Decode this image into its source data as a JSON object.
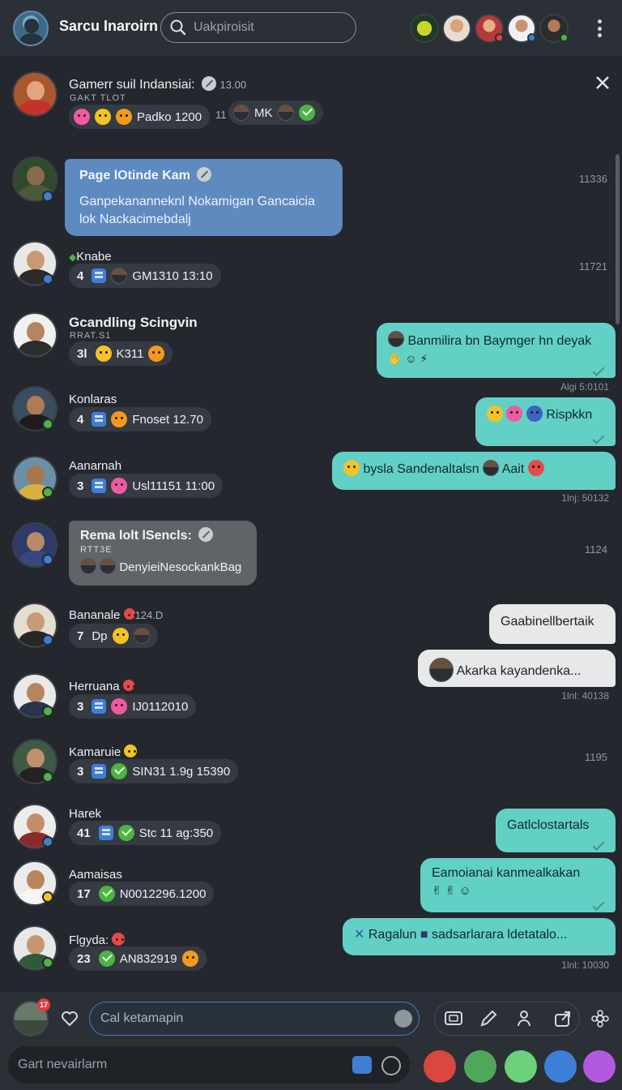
{
  "header": {
    "app_title": "Sarcu Inaroirn",
    "search_placeholder": "Uakpiroisit"
  },
  "pinned": {
    "name": "Gamerr suil Indansiai:",
    "time": "13.00",
    "sub": "GAKT TLOT",
    "chip_text": "Padko 1200",
    "extra_count": "11",
    "extra_chip_text": "MK"
  },
  "rows": [
    {
      "name": "Page lOtinde Kam",
      "message": "Ganpekananneknl Nokamigan Gancaicia lok Nackacimebdalj",
      "time": "11336"
    },
    {
      "name": "Knabe",
      "count": "4",
      "chip_text": "GM1310 13:10",
      "time": "11721"
    },
    {
      "name": "Gcandling Scingvin",
      "sub": "RRAT.S1",
      "count": "3l",
      "chip_text": "K311"
    },
    {
      "name": "Konlaras",
      "count": "4",
      "chip_text": "Fnoset 12.70"
    },
    {
      "name": "Aanarnah",
      "count": "3",
      "chip_text": "Usl11151 11:00"
    },
    {
      "name": "Rema lolt lSencls:",
      "sub": "RTT3E",
      "chip_text": "DenyieiNesockankBag",
      "time": "1124"
    },
    {
      "name": "Bananale",
      "badge_text": "124.D",
      "count": "7",
      "chip_text": "Dp"
    },
    {
      "name": "Herruana",
      "count": "3",
      "chip_text": "IJ0112010"
    },
    {
      "name": "Kamaruie",
      "count": "3",
      "chip_text": "SIN31 1.9g 15390",
      "time": "1195"
    },
    {
      "name": "Harek",
      "count": "41",
      "chip_text": "Stc 11 ag:350"
    },
    {
      "name": "Aamaisas",
      "count": "17",
      "chip_text": "N0012296.1200"
    },
    {
      "name": "Flgyda:",
      "count": "23",
      "chip_text": "AN832919"
    }
  ],
  "outgoing": [
    {
      "text": "Banmilira bn Baymger hn deyak"
    },
    {
      "text": "Rispkkn"
    },
    {
      "text": "bysla Sandenaltalsn",
      "text2": "Aait"
    },
    {
      "text": "Gaabinellbertaik"
    },
    {
      "text": "Akarka kayandenka..."
    },
    {
      "text": "Gatlclostartals"
    },
    {
      "text": "Eamoianai kanmealkakan"
    },
    {
      "text": "Ragalun",
      "text2": "sadsarlarara ldetatalo..."
    }
  ],
  "bubble_times": [
    "Algi 5:0101",
    "1lnj: 50132",
    "1lnl: 40138",
    "1lnl: 10030"
  ],
  "composer": {
    "badge": "17",
    "input_placeholder": "Cal ketamapin",
    "bottom_placeholder": "Gart nevairlarm"
  },
  "icons": [
    "search-icon",
    "close-icon",
    "heart-icon",
    "pencil-icon",
    "gear-icon"
  ],
  "colors": {
    "accent_teal": "#63d0c6",
    "accent_blue": "#5e8ac0",
    "background": "#24272d"
  }
}
